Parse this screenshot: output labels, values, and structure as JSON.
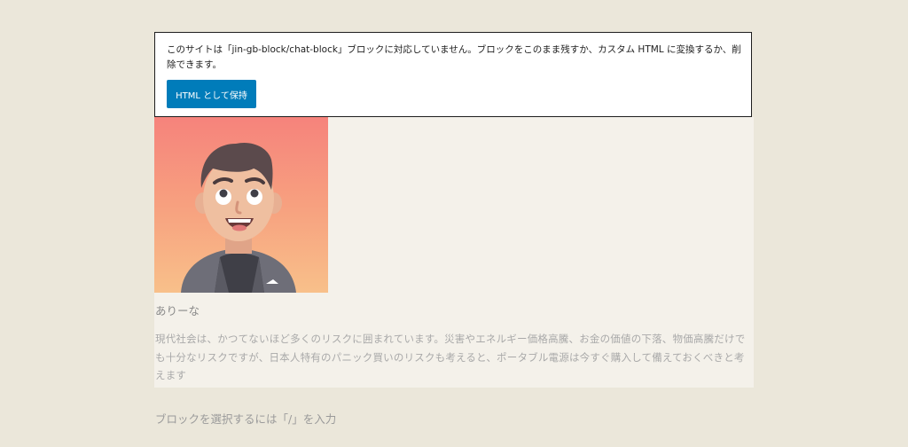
{
  "notice": {
    "message": "このサイトは「jin-gb-block/chat-block」ブロックに対応していません。ブロックをこのまま残すか、カスタム HTML に変換するか、削除できます。",
    "keep_html_label": "HTML として保持"
  },
  "chat_block": {
    "avatar_icon": "avatar-man-smiling",
    "speaker_name": "ありーな",
    "text": "現代社会は、かつてないほど多くのリスクに囲まれています。災害やエネルギー価格高騰、お金の価値の下落、物価高騰だけでも十分なリスクですが、日本人特有のパニック買いのリスクも考えると、ポータブル電源は今すぐ購入して備えておくべきと考えます"
  },
  "editor": {
    "block_placeholder": "ブロックを選択するには「/」を入力"
  },
  "colors": {
    "page_background": "#ebe7da",
    "block_background": "#f4f1ea",
    "primary_button": "#007cba"
  }
}
